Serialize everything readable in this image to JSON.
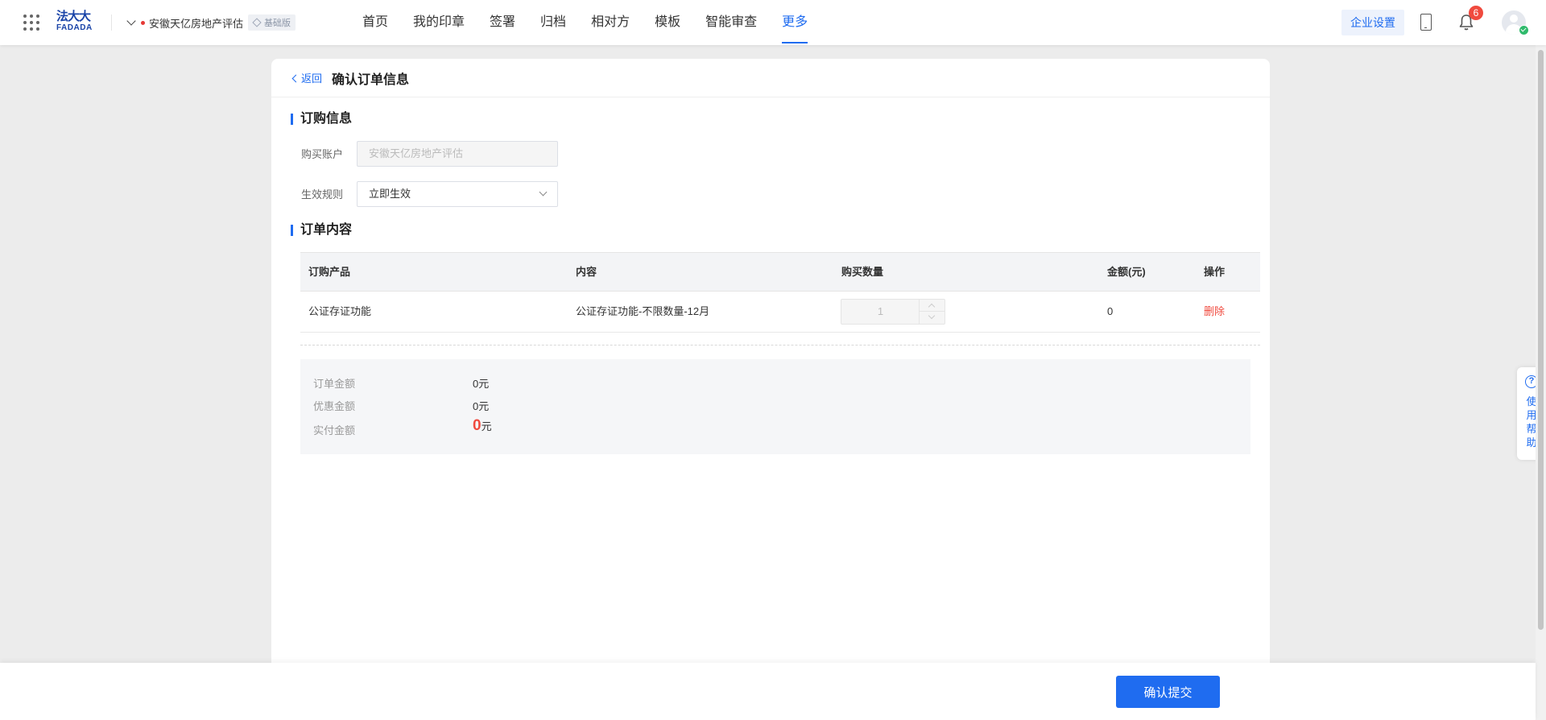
{
  "header": {
    "logo_line1": "法大大",
    "logo_line2": "FADADA",
    "org_name": "安徽天亿房地产评估",
    "tier_badge": "基础版",
    "nav": [
      "首页",
      "我的印章",
      "签署",
      "归档",
      "相对方",
      "模板",
      "智能审查",
      "更多"
    ],
    "active_nav": "更多",
    "enterprise_settings": "企业设置",
    "notification_count": "6"
  },
  "page": {
    "back_label": "返回",
    "title": "确认订单信息"
  },
  "order_info": {
    "section_title": "订购信息",
    "account_label": "购买账户",
    "account_value": "安徽天亿房地产评估",
    "rule_label": "生效规则",
    "rule_value": "立即生效"
  },
  "order_content": {
    "section_title": "订单内容",
    "columns": [
      "订购产品",
      "内容",
      "购买数量",
      "金额(元)",
      "操作"
    ],
    "rows": [
      {
        "product": "公证存证功能",
        "content": "公证存证功能-不限数量-12月",
        "quantity": "1",
        "amount": "0",
        "action": "删除"
      }
    ]
  },
  "summary": {
    "order_amount_label": "订单金额",
    "order_amount_value": "0元",
    "discount_label": "优惠金额",
    "discount_value": "0元",
    "paid_label": "实付金额",
    "paid_amount": "0",
    "paid_unit": "元"
  },
  "help": {
    "icon": "?",
    "label": "使用帮助"
  },
  "footer": {
    "submit_label": "确认提交"
  },
  "colors": {
    "primary": "#1f6cf0",
    "danger": "#f04a3e",
    "brand": "#1a44a8"
  }
}
